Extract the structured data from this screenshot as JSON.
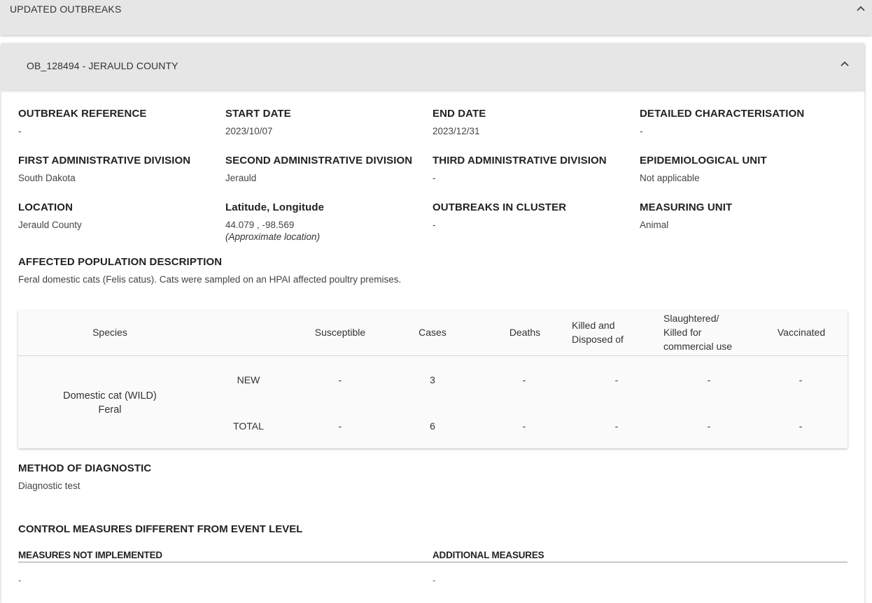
{
  "section": {
    "title": "UPDATED OUTBREAKS",
    "chevron_icon": "chevron-up-icon"
  },
  "outbreak": {
    "title": "OB_128494 - JERAULD COUNTY",
    "chevron_icon": "chevron-up-icon",
    "fields": {
      "outbreak_reference": {
        "label": "OUTBREAK REFERENCE",
        "value": "-"
      },
      "start_date": {
        "label": "START DATE",
        "value": "2023/10/07"
      },
      "end_date": {
        "label": "END DATE",
        "value": "2023/12/31"
      },
      "detailed_characterisation": {
        "label": "DETAILED CHARACTERISATION",
        "value": "-"
      },
      "first_admin_division": {
        "label": "FIRST ADMINISTRATIVE DIVISION",
        "value": "South Dakota"
      },
      "second_admin_division": {
        "label": "SECOND ADMINISTRATIVE DIVISION",
        "value": "Jerauld"
      },
      "third_admin_division": {
        "label": "THIRD ADMINISTRATIVE DIVISION",
        "value": "-"
      },
      "epidemiological_unit": {
        "label": "EPIDEMIOLOGICAL UNIT",
        "value": "Not applicable"
      },
      "location": {
        "label": "LOCATION",
        "value": "Jerauld County"
      },
      "lat_long": {
        "label": "Latitude, Longitude",
        "value": "44.079 , -98.569",
        "note": "(Approximate location)"
      },
      "outbreaks_in_cluster": {
        "label": "OUTBREAKS IN CLUSTER",
        "value": "-"
      },
      "measuring_unit": {
        "label": "MEASURING UNIT",
        "value": "Animal"
      },
      "affected_population": {
        "label": "AFFECTED POPULATION DESCRIPTION",
        "value": "Feral domestic cats (Felis catus). Cats were sampled on an HPAI affected poultry premises."
      }
    },
    "table": {
      "headers": {
        "species": "Species",
        "susceptible": "Susceptible",
        "cases": "Cases",
        "deaths": "Deaths",
        "killed_line1": "Killed and",
        "killed_line2": "Disposed of",
        "slaughtered_line1": "Slaughtered/",
        "slaughtered_line2": "Killed for",
        "slaughtered_line3": "commercial use",
        "vaccinated": "Vaccinated"
      },
      "species_line1": "Domestic cat (WILD)",
      "species_line2": "Feral",
      "rows": [
        {
          "label": "NEW",
          "susceptible": "-",
          "cases": "3",
          "deaths": "-",
          "killed": "-",
          "slaughtered": "-",
          "vaccinated": "-"
        },
        {
          "label": "TOTAL",
          "susceptible": "-",
          "cases": "6",
          "deaths": "-",
          "killed": "-",
          "slaughtered": "-",
          "vaccinated": "-"
        }
      ]
    },
    "method_of_diagnostic": {
      "label": "METHOD OF DIAGNOSTIC",
      "value": "Diagnostic test"
    },
    "control_measures": {
      "heading": "CONTROL MEASURES DIFFERENT FROM EVENT LEVEL",
      "not_implemented_label": "MEASURES NOT IMPLEMENTED",
      "not_implemented_value": "-",
      "additional_label": "ADDITIONAL MEASURES",
      "additional_value": "-"
    }
  }
}
